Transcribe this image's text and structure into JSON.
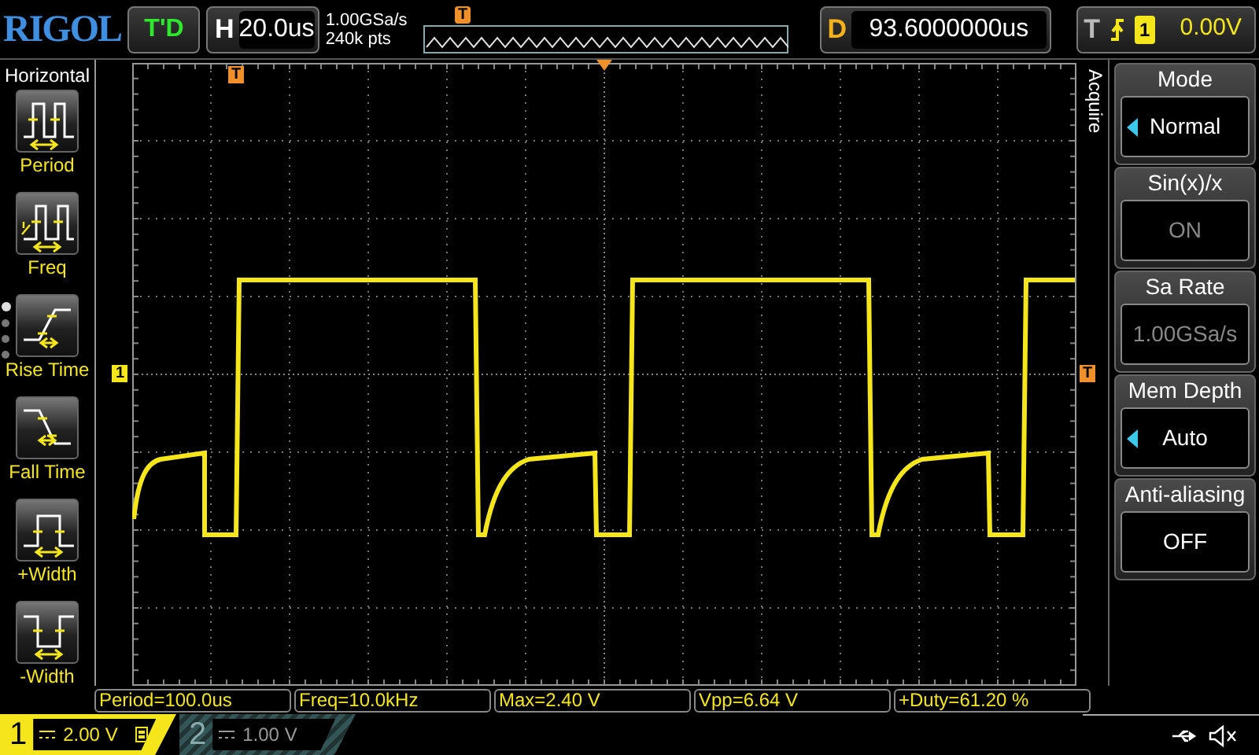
{
  "logo": "RIGOL",
  "run_status": "T'D",
  "timebase": {
    "label": "H",
    "value": "20.0us"
  },
  "acquisition": {
    "sample_rate": "1.00GSa/s",
    "memory_points": "240k pts"
  },
  "memory_overview": {
    "trigger_marker": "T"
  },
  "delay": {
    "label": "D",
    "value": "93.6000000us"
  },
  "trigger": {
    "label": "T",
    "source": "1",
    "level": "0.00V"
  },
  "left_menu": {
    "title": "Horizontal",
    "pages": [
      {
        "selected": true
      },
      {
        "selected": false
      },
      {
        "selected": false
      },
      {
        "selected": false
      }
    ],
    "items": [
      {
        "kind": "period",
        "label": "Period"
      },
      {
        "kind": "freq",
        "label": "Freq"
      },
      {
        "kind": "rise",
        "label": "Rise Time"
      },
      {
        "kind": "fall",
        "label": "Fall Time"
      },
      {
        "kind": "pwidth",
        "label": "+Width"
      },
      {
        "kind": "nwidth",
        "label": "-Width"
      }
    ]
  },
  "display": {
    "trigger_position_marker": "T",
    "channel_marker": "1",
    "trigger_level_marker": "T"
  },
  "right_menu": {
    "title": "Acquire",
    "items": [
      {
        "title": "Mode",
        "value": "Normal",
        "selectable": true,
        "disabled": false
      },
      {
        "title": "Sin(x)/x",
        "value": "ON",
        "selectable": false,
        "disabled": true
      },
      {
        "title": "Sa Rate",
        "value": "1.00GSa/s",
        "selectable": false,
        "disabled": true
      },
      {
        "title": "Mem Depth",
        "value": "Auto",
        "selectable": true,
        "disabled": false
      },
      {
        "title": "Anti-aliasing",
        "value": "OFF",
        "selectable": false,
        "disabled": false
      }
    ]
  },
  "measurements": [
    "Period=100.0us",
    "Freq=10.0kHz",
    "Max=2.40 V",
    "Vpp=6.64 V",
    "+Duty=61.20 %"
  ],
  "channels": [
    {
      "number": "1",
      "scale": "2.00 V",
      "active": true
    },
    {
      "number": "2",
      "scale": "1.00 V",
      "active": false
    }
  ]
}
